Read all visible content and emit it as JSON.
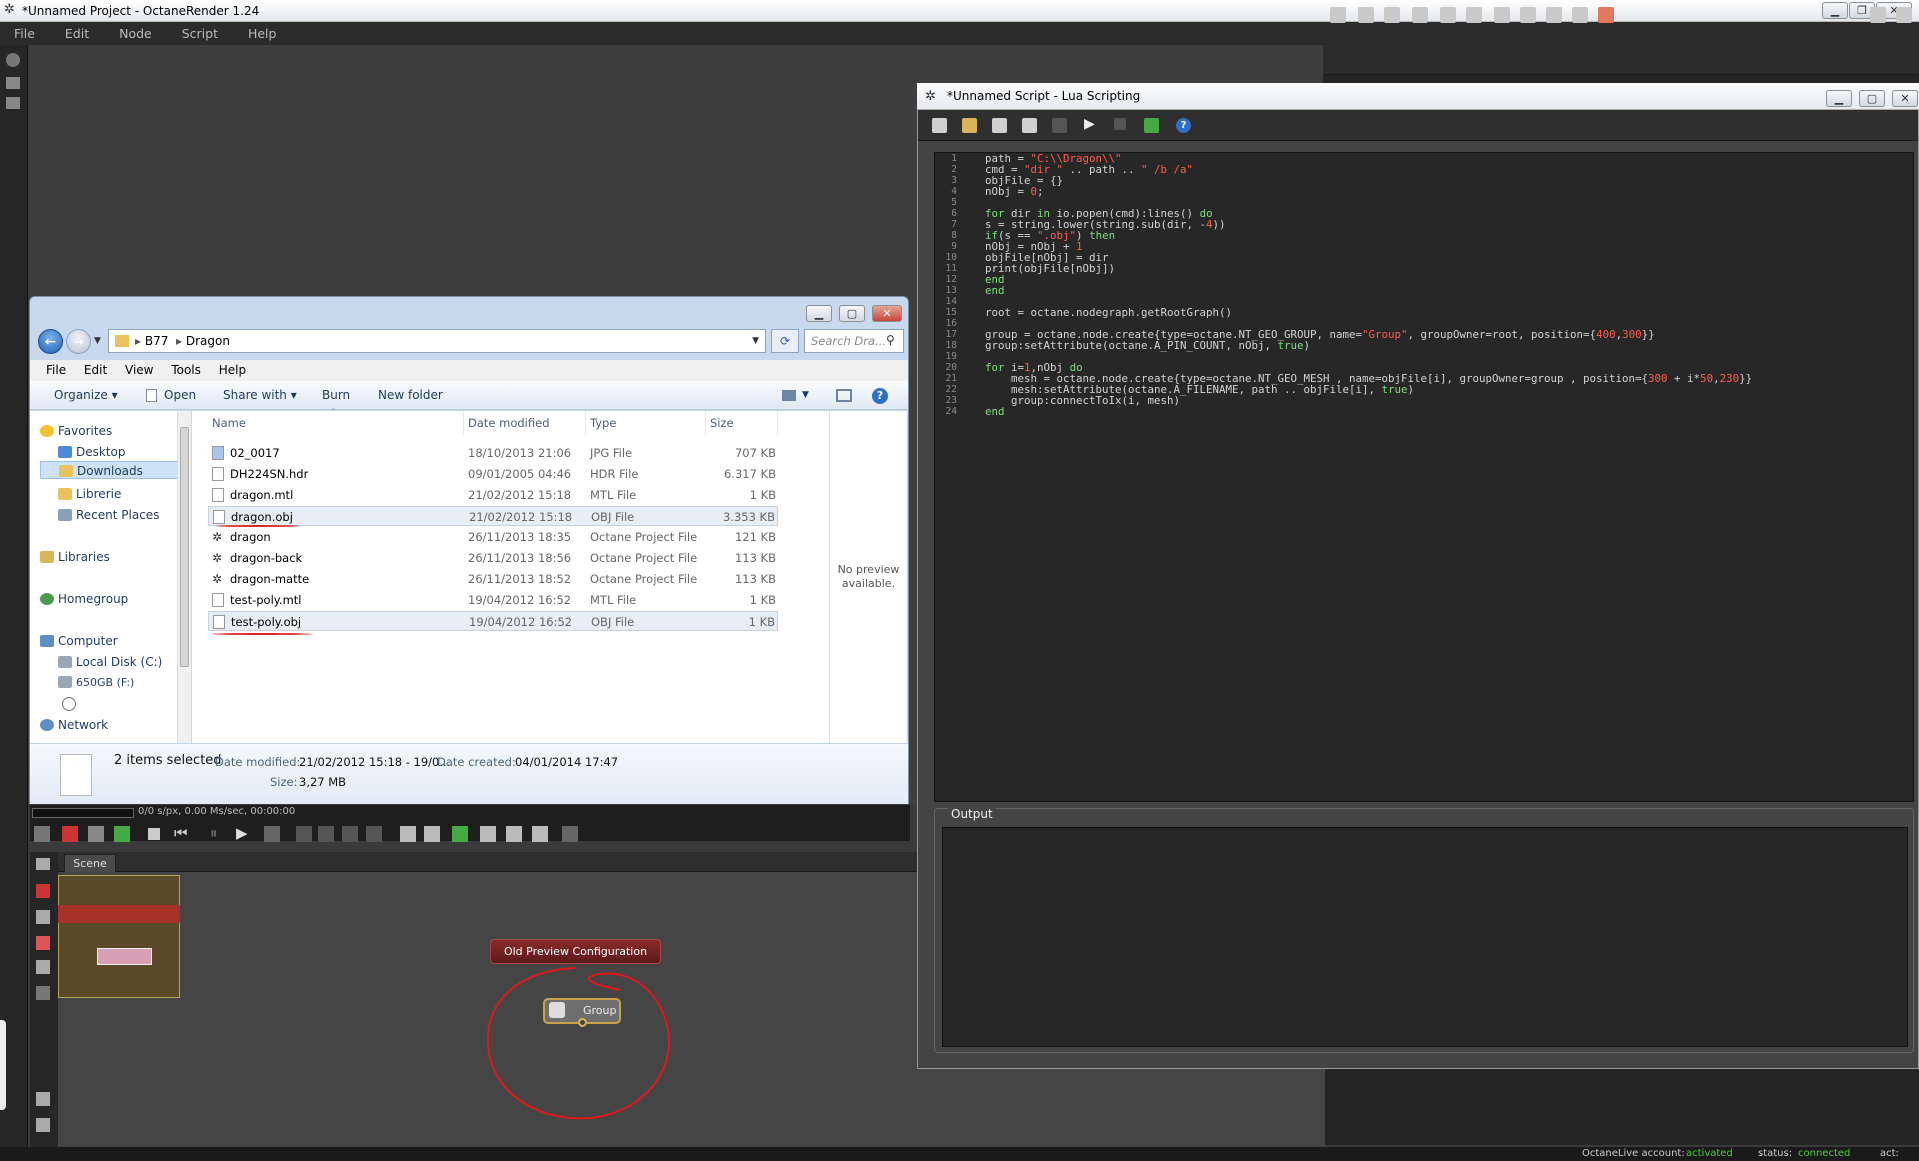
{
  "app": {
    "title": "*Unnamed Project - OctaneRender 1.24",
    "menu": [
      "File",
      "Edit",
      "Node",
      "Script",
      "Help"
    ]
  },
  "render": {
    "stats": "0/0 s/px, 0.00 Ms/sec, 00:00:00"
  },
  "scene": {
    "tab": "Scene",
    "nodes": {
      "preview_config": "Old Preview Configuration",
      "group": "Group"
    }
  },
  "status": {
    "account_label": "OctaneLive account:",
    "account_value": "activated",
    "status_label": "status:",
    "status_value": "connected",
    "act_label": "act:"
  },
  "explorer": {
    "path": [
      "B77",
      "Dragon"
    ],
    "search_placeholder": "Search Dra...",
    "menu": [
      "File",
      "Edit",
      "View",
      "Tools",
      "Help"
    ],
    "commands": {
      "organize": "Organize",
      "open": "Open",
      "share": "Share with",
      "burn": "Burn",
      "new_folder": "New folder"
    },
    "nav": {
      "favorites": "Favorites",
      "desktop": "Desktop",
      "downloads": "Downloads",
      "librerie": "Librerie",
      "recent": "Recent Places",
      "libraries": "Libraries",
      "homegroup": "Homegroup",
      "computer": "Computer",
      "local_disk": "Local Disk (C:)",
      "drive_f": "650GB (F:)",
      "network": "Network"
    },
    "columns": {
      "name": "Name",
      "date": "Date modified",
      "type": "Type",
      "size": "Size"
    },
    "files": [
      {
        "name": "02_0017",
        "date": "18/10/2013 21:06",
        "type": "JPG File",
        "size": "707 KB"
      },
      {
        "name": "DH224SN.hdr",
        "date": "09/01/2005 04:46",
        "type": "HDR File",
        "size": "6.317 KB"
      },
      {
        "name": "dragon.mtl",
        "date": "21/02/2012 15:18",
        "type": "MTL File",
        "size": "1 KB"
      },
      {
        "name": "dragon.obj",
        "date": "21/02/2012 15:18",
        "type": "OBJ File",
        "size": "3.353 KB"
      },
      {
        "name": "dragon",
        "date": "26/11/2013 18:35",
        "type": "Octane Project File",
        "size": "121 KB"
      },
      {
        "name": "dragon-back",
        "date": "26/11/2013 18:56",
        "type": "Octane Project File",
        "size": "113 KB"
      },
      {
        "name": "dragon-matte",
        "date": "26/11/2013 18:52",
        "type": "Octane Project File",
        "size": "113 KB"
      },
      {
        "name": "test-poly.mtl",
        "date": "19/04/2012 16:52",
        "type": "MTL File",
        "size": "1 KB"
      },
      {
        "name": "test-poly.obj",
        "date": "19/04/2012 16:52",
        "type": "OBJ File",
        "size": "1 KB"
      }
    ],
    "preview": "No preview available.",
    "details": {
      "selected": "2 items selected",
      "modified_label": "Date modified:",
      "modified_value": "21/02/2012 15:18 - 19/0...",
      "created_label": "Date created:",
      "created_value": "04/01/2014 17:47",
      "size_label": "Size:",
      "size_value": "3,27 MB"
    }
  },
  "lua": {
    "title": "*Unnamed Script - Lua Scripting",
    "output_label": "Output"
  }
}
